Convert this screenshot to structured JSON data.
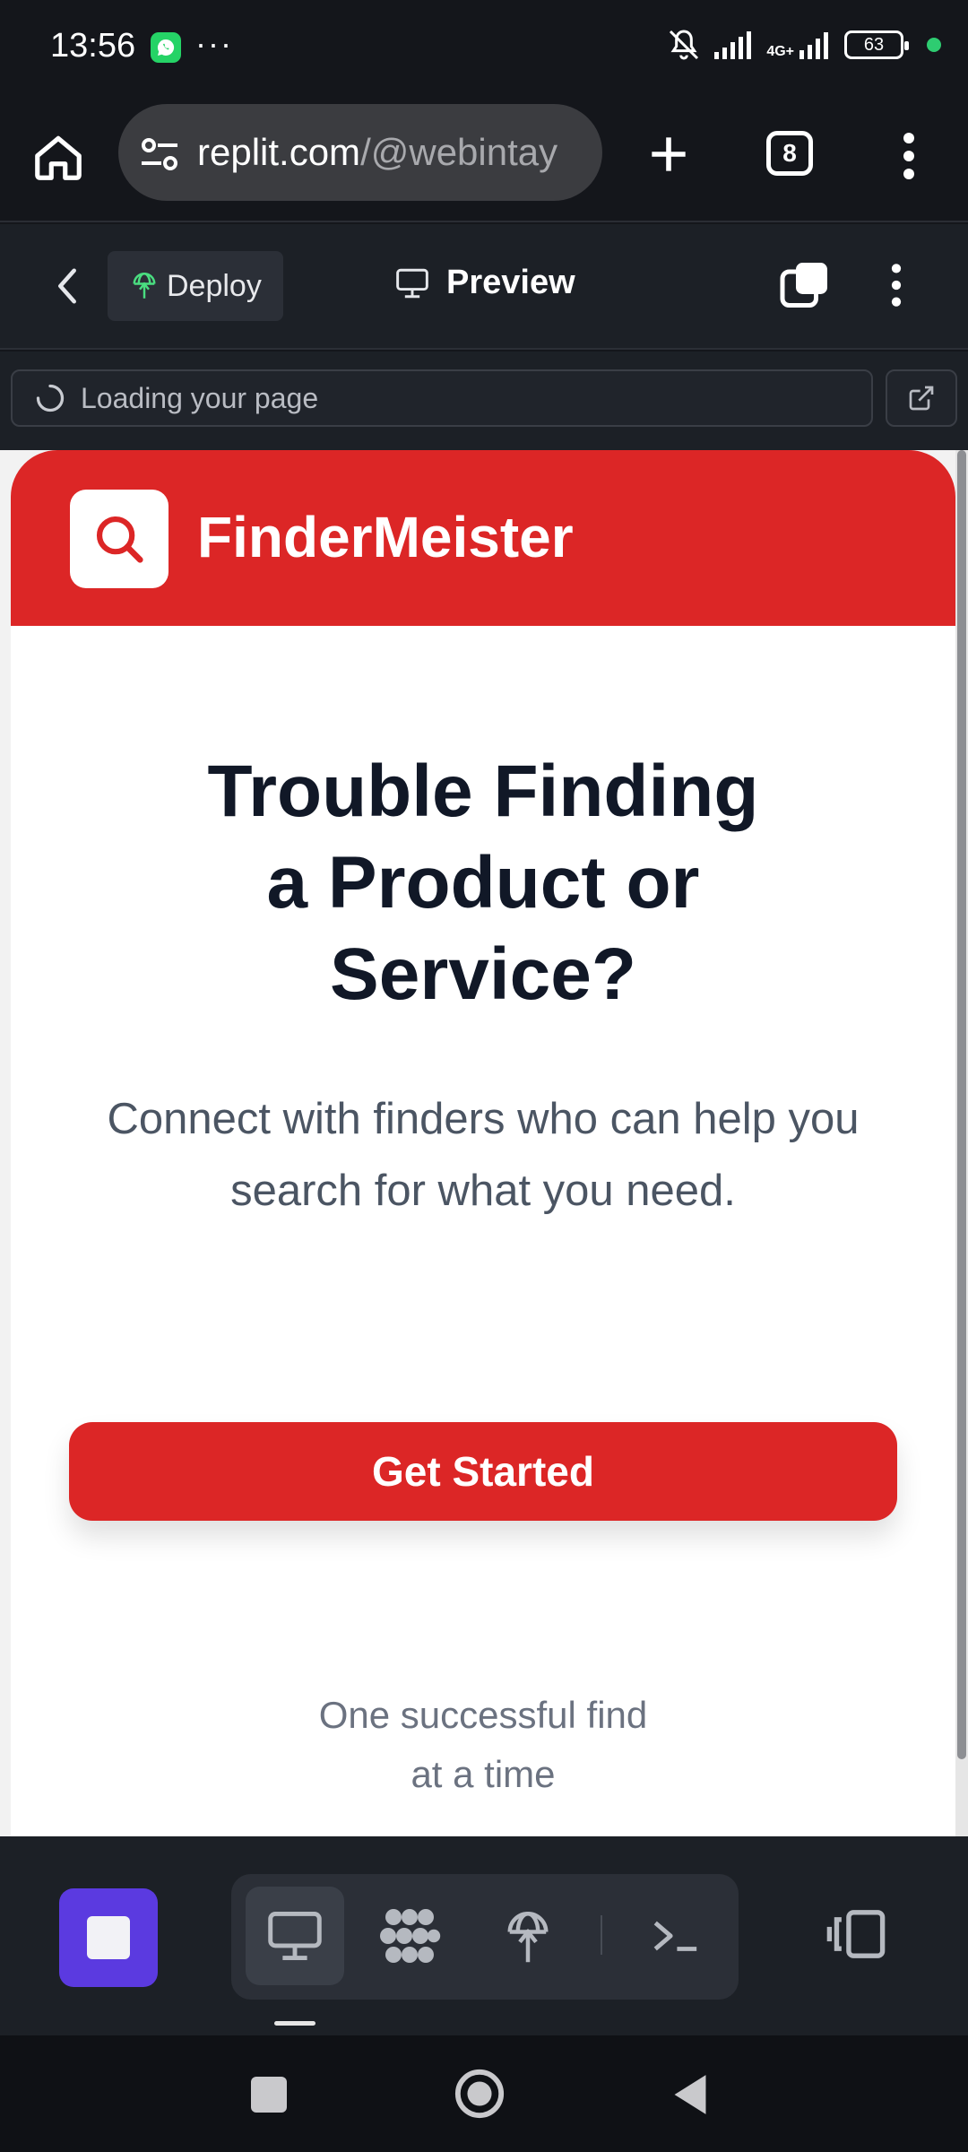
{
  "status_bar": {
    "time": "13:56",
    "more": "···",
    "network": "4G+",
    "battery": "63",
    "icons": [
      "whatsapp-icon",
      "mute-bell-icon",
      "signal-icon",
      "signal-4g-icon",
      "battery-icon",
      "green-dot-icon"
    ]
  },
  "browser": {
    "url_host": "replit.com",
    "url_path": "/@webintay",
    "tab_count": "8",
    "icons": [
      "home-icon",
      "site-settings-icon",
      "plus-icon",
      "kebab-icon"
    ]
  },
  "replit_header": {
    "deploy_label": "Deploy",
    "preview_label": "Preview"
  },
  "loading": {
    "text": "Loading your page"
  },
  "site": {
    "brand": "FinderMeister",
    "headline_line1": "Trouble Finding",
    "headline_line2": "a Product or",
    "headline_line3": "Service?",
    "subtext_line1": "Connect with finders who can help you",
    "subtext_line2": "search for what you need.",
    "cta_label": "Get Started",
    "tagline_line1": "One successful find",
    "tagline_line2": "at a time",
    "colors": {
      "brand_red": "#dc2626",
      "headline": "#111827",
      "body": "#4b5563"
    }
  },
  "replit_bottom": {
    "icons": [
      "stop-icon",
      "monitor-icon",
      "extensions-icon",
      "deploy-icon",
      "shell-icon",
      "device-toggle-icon"
    ],
    "accent": "#5b3ae0"
  },
  "android_nav": {
    "icons": [
      "recents-icon",
      "home-circle-icon",
      "back-triangle-icon"
    ]
  }
}
